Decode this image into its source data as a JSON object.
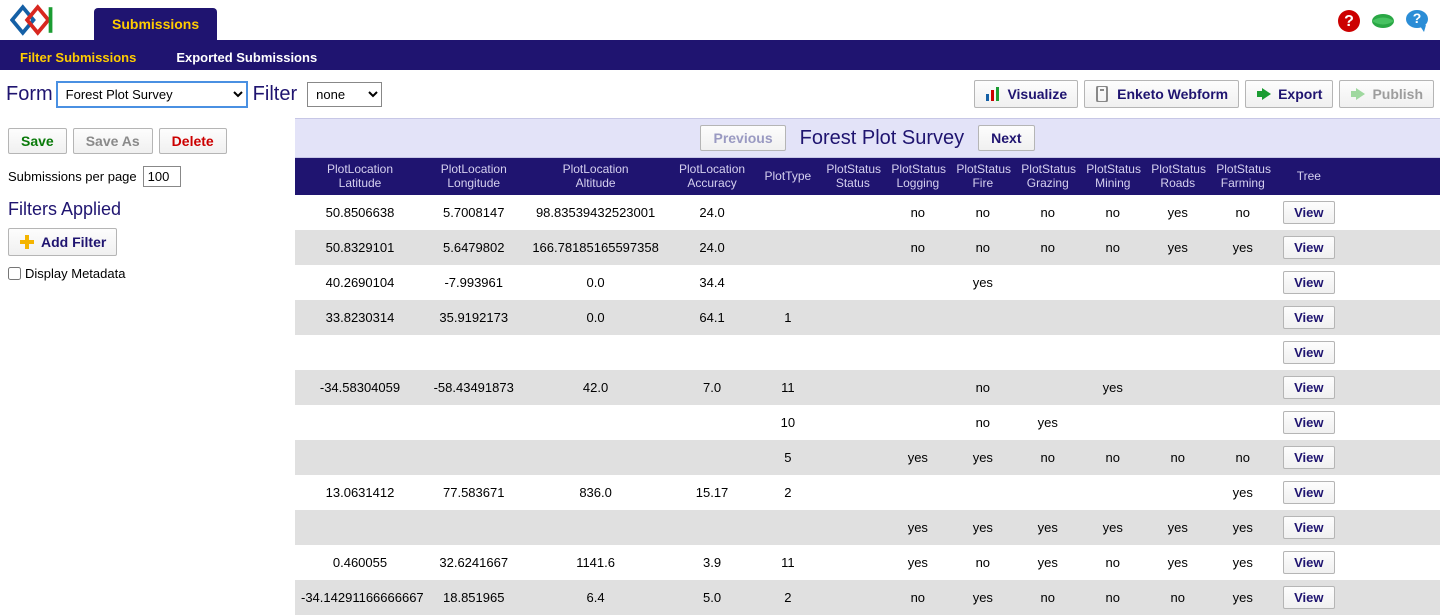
{
  "top": {
    "tab_label": "Submissions",
    "subnav": [
      {
        "label": "Filter Submissions",
        "active": true
      },
      {
        "label": "Exported Submissions",
        "active": false
      }
    ]
  },
  "formrow": {
    "form_label": "Form",
    "form_selected": "Forest Plot Survey",
    "filter_label": "Filter",
    "filter_selected": "none",
    "actions": {
      "visualize": "Visualize",
      "webform": "Enketo Webform",
      "export": "Export",
      "publish": "Publish"
    }
  },
  "left": {
    "save": "Save",
    "save_as": "Save As",
    "delete": "Delete",
    "spp_label": "Submissions per page",
    "spp_value": "100",
    "filters_heading": "Filters Applied",
    "add_filter_label": "Add Filter",
    "display_metadata_label": "Display Metadata"
  },
  "content": {
    "prev": "Previous",
    "next": "Next",
    "title": "Forest Plot Survey",
    "view_label": "View",
    "headers": [
      "PlotLocation Latitude",
      "PlotLocation Longitude",
      "PlotLocation Altitude",
      "PlotLocation Accuracy",
      "PlotType",
      "PlotStatus Status",
      "PlotStatus Logging",
      "PlotStatus Fire",
      "PlotStatus Grazing",
      "PlotStatus Mining",
      "PlotStatus Roads",
      "PlotStatus Farming",
      "Tree",
      ""
    ],
    "rows": [
      {
        "c": [
          "50.8506638",
          "5.7008147",
          "98.83539432523001",
          "24.0",
          "",
          "",
          "no",
          "no",
          "no",
          "no",
          "yes",
          "no"
        ]
      },
      {
        "c": [
          "50.8329101",
          "5.6479802",
          "166.78185165597358",
          "24.0",
          "",
          "",
          "no",
          "no",
          "no",
          "no",
          "yes",
          "yes"
        ]
      },
      {
        "c": [
          "40.2690104",
          "-7.993961",
          "0.0",
          "34.4",
          "",
          "",
          "",
          "yes",
          "",
          "",
          "",
          ""
        ]
      },
      {
        "c": [
          "33.8230314",
          "35.9192173",
          "0.0",
          "64.1",
          "1",
          "",
          "",
          "",
          "",
          "",
          "",
          ""
        ]
      },
      {
        "c": [
          "",
          "",
          "",
          "",
          "",
          "",
          "",
          "",
          "",
          "",
          "",
          ""
        ]
      },
      {
        "c": [
          "-34.58304059",
          "-58.43491873",
          "42.0",
          "7.0",
          "11",
          "",
          "",
          "no",
          "",
          "yes",
          "",
          ""
        ]
      },
      {
        "c": [
          "",
          "",
          "",
          "",
          "10",
          "",
          "",
          "no",
          "yes",
          "",
          "",
          ""
        ]
      },
      {
        "c": [
          "",
          "",
          "",
          "",
          "5",
          "",
          "yes",
          "yes",
          "no",
          "no",
          "no",
          "no"
        ]
      },
      {
        "c": [
          "13.0631412",
          "77.583671",
          "836.0",
          "15.17",
          "2",
          "",
          "",
          "",
          "",
          "",
          "",
          "yes"
        ]
      },
      {
        "c": [
          "",
          "",
          "",
          "",
          "",
          "",
          "yes",
          "yes",
          "yes",
          "yes",
          "yes",
          "yes"
        ]
      },
      {
        "c": [
          "0.460055",
          "32.6241667",
          "1141.6",
          "3.9",
          "11",
          "",
          "yes",
          "no",
          "yes",
          "no",
          "yes",
          "yes"
        ]
      },
      {
        "c": [
          "-34.14291166666667",
          "18.851965",
          "6.4",
          "5.0",
          "2",
          "",
          "no",
          "yes",
          "no",
          "no",
          "no",
          "yes"
        ]
      }
    ]
  }
}
